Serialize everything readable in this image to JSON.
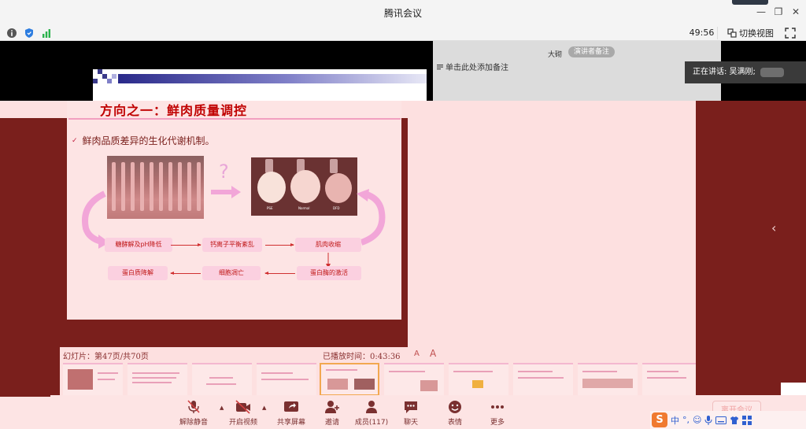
{
  "window": {
    "title": "腾讯会议"
  },
  "toolbar": {
    "timer": "49:56",
    "switch_view_label": "切换视图",
    "icons": [
      "info-icon",
      "shield-icon",
      "signal-icon",
      "switch-view-icon",
      "fullscreen-icon"
    ]
  },
  "presenter": {
    "name": "大砌",
    "notes_button": "演讲者备注",
    "add_note": "单击此处添加备注"
  },
  "speaking": {
    "label": "正在讲话: 吴满刚;"
  },
  "slide": {
    "title": "方向之一：鲜肉质量调控",
    "bullet": "鲜肉品质差异的生化代谢机制。",
    "question_mark": "?",
    "photo_captions": [
      "PSE",
      "Normal",
      "DFD"
    ],
    "flow_row1": [
      "糖酵解及pH降低",
      "钙离子平衡紊乱",
      "肌肉收缩"
    ],
    "flow_row2": [
      "蛋白质降解",
      "细胞凋亡",
      "蛋白酶的激活"
    ]
  },
  "navigator": {
    "slide_counter": "幻灯片：第47页/共70页",
    "played_time": "已播放时间：0:43:36",
    "font_small": "A",
    "font_large": "A",
    "active_thumb": 4
  },
  "controls": {
    "mute": "解除静音",
    "video": "开启视频",
    "share": "共享屏幕",
    "invite": "邀请",
    "members": "成员(117)",
    "chat": "聊天",
    "reaction": "表情",
    "more": "更多",
    "end": "离开会议"
  },
  "ime": {
    "mode": "中"
  },
  "colors": {
    "accent_red": "#c00000",
    "slide_bg": "#fde4e4",
    "window_bg": "#7a1f1c"
  }
}
